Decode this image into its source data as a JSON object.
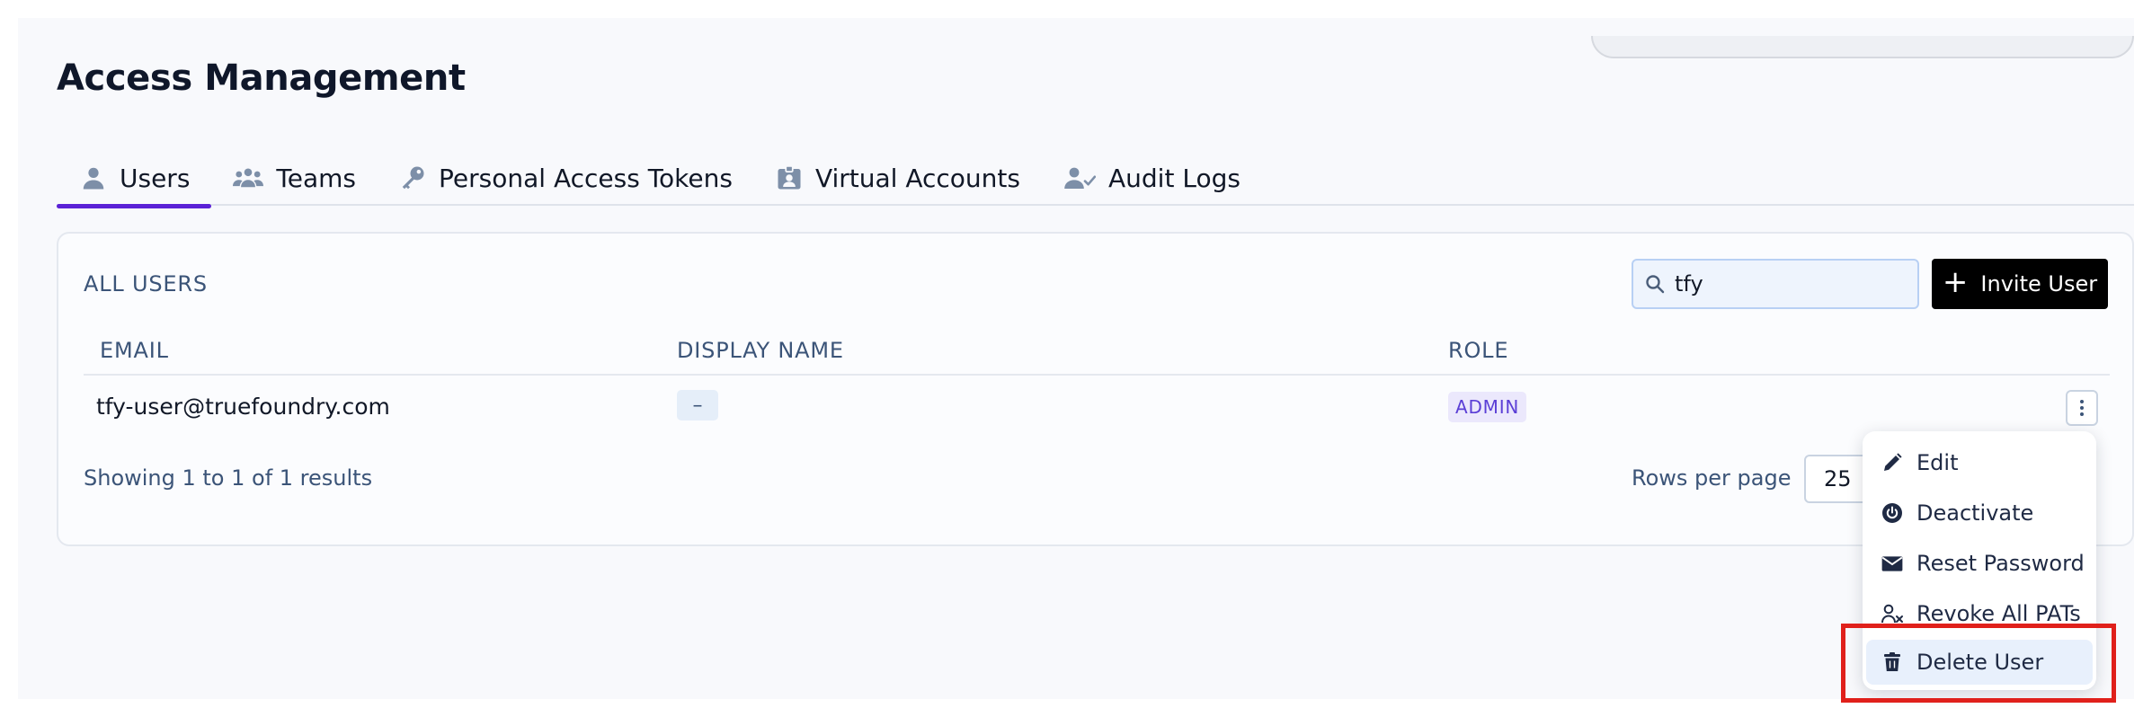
{
  "page": {
    "title": "Access Management"
  },
  "tabs": [
    {
      "label": "Users",
      "icon": "user-icon",
      "active": true
    },
    {
      "label": "Teams",
      "icon": "team-icon",
      "active": false
    },
    {
      "label": "Personal Access Tokens",
      "icon": "key-icon",
      "active": false
    },
    {
      "label": "Virtual Accounts",
      "icon": "id-badge-icon",
      "active": false
    },
    {
      "label": "Audit Logs",
      "icon": "user-check-icon",
      "active": false
    }
  ],
  "users_panel": {
    "section_title": "ALL USERS",
    "search": {
      "value": "tfy",
      "icon": "search-icon"
    },
    "invite_button": {
      "label": "Invite User",
      "icon": "plus-icon"
    },
    "columns": [
      "EMAIL",
      "DISPLAY NAME",
      "ROLE"
    ],
    "rows": [
      {
        "email": "tfy-user@truefoundry.com",
        "display_name": "–",
        "role": "ADMIN"
      }
    ],
    "footer": {
      "showing": "Showing 1 to 1 of 1 results",
      "rows_per_page_label": "Rows per page",
      "rows_per_page_value": "25"
    }
  },
  "row_menu": {
    "items": [
      {
        "label": "Edit",
        "icon": "pencil-icon"
      },
      {
        "label": "Deactivate",
        "icon": "power-icon"
      },
      {
        "label": "Reset Password",
        "icon": "envelope-icon"
      },
      {
        "label": "Revoke All PATs",
        "icon": "user-x-icon"
      },
      {
        "label": "Delete User",
        "icon": "trash-icon",
        "hovered": true
      }
    ]
  },
  "colors": {
    "accent": "#5b21d6",
    "highlight": "#e0201b",
    "label": "#3b5478",
    "admin_chip_text": "#5b3fd6"
  }
}
